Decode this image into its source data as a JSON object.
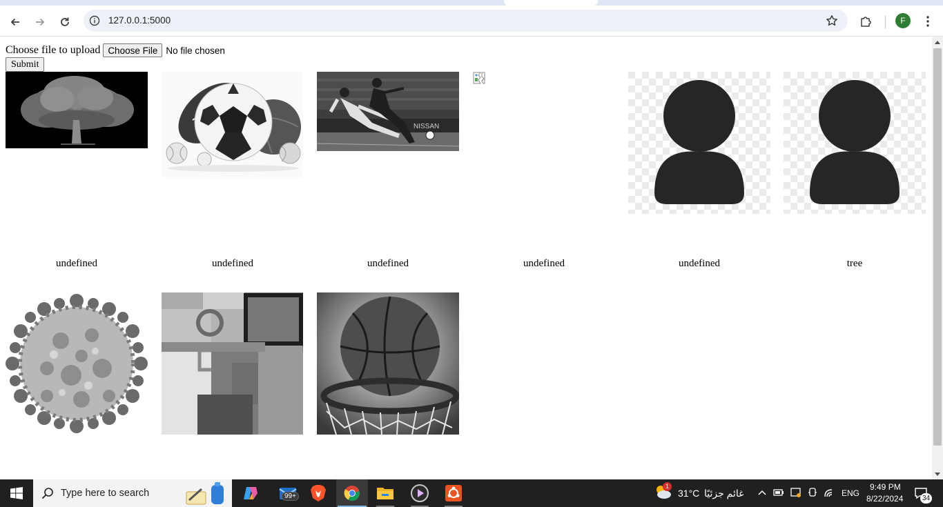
{
  "browser": {
    "url": "127.0.0.1:5000",
    "profile_initial": "F",
    "icons": [
      "back-icon",
      "forward-icon",
      "reload-icon",
      "site-info-icon",
      "bookmark-star-icon",
      "extensions-icon",
      "menu-icon"
    ]
  },
  "upload_form": {
    "label": "Choose file to upload",
    "file_button": "Choose File",
    "file_status": "No file chosen",
    "submit": "Submit"
  },
  "gallery": {
    "row1": [
      {
        "image": "tree",
        "caption": "undefined"
      },
      {
        "image": "sports-balls",
        "caption": "undefined"
      },
      {
        "image": "soccer-players",
        "caption": "undefined"
      },
      {
        "image": "broken-image",
        "caption": "undefined"
      },
      {
        "image": "user-placeholder",
        "caption": "undefined"
      },
      {
        "image": "user-placeholder",
        "caption": "tree"
      }
    ],
    "row2": [
      {
        "image": "virus"
      },
      {
        "image": "abstract-shapes"
      },
      {
        "image": "basketball"
      }
    ]
  },
  "taskbar": {
    "search_placeholder": "Type here to search",
    "mail_badge": "99+",
    "weather_badge": "1",
    "temperature": "31°C",
    "weather_text": "غائم جزئيًا",
    "language": "ENG",
    "time": "9:49 PM",
    "date": "8/22/2024",
    "notifications": "34",
    "apps": [
      "copilot-icon",
      "mail-icon",
      "brave-icon",
      "chrome-icon",
      "file-explorer-icon",
      "media-player-icon",
      "ubuntu-icon"
    ]
  }
}
